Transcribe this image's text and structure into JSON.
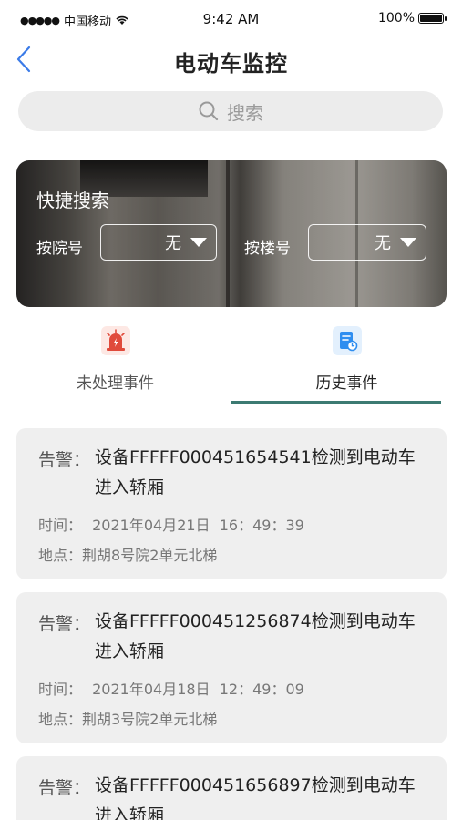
{
  "status_bar": {
    "carrier": "中国移动",
    "time": "9:42 AM",
    "battery": "100%"
  },
  "nav": {
    "title": "电动车监控"
  },
  "search": {
    "placeholder": "搜索"
  },
  "quick_search": {
    "title": "快捷搜索",
    "by_court_label": "按院号",
    "by_court_value": "无",
    "by_building_label": "按楼号",
    "by_building_value": "无"
  },
  "tabs": [
    {
      "label": "未处理事件",
      "icon": "alarm-light-icon",
      "color": "#e04a3b"
    },
    {
      "label": "历史事件",
      "icon": "history-doc-icon",
      "color": "#2f8ef0",
      "active": true
    }
  ],
  "colors": {
    "accent": "#3c7a72",
    "card_bg": "#efefef"
  },
  "events": [
    {
      "alarm_label": "告警：",
      "alarm_text": "设备FFFFF000451654541检测到电动车进入轿厢",
      "time_label": "时间：",
      "time": "2021年04月21日  16：49：39",
      "location_label": "地点：",
      "location": "荆胡8号院2单元北梯"
    },
    {
      "alarm_label": "告警：",
      "alarm_text": "设备FFFFF000451256874检测到电动车进入轿厢",
      "time_label": "时间：",
      "time": "2021年04月18日  12：49：09",
      "location_label": "地点：",
      "location": "荆胡3号院2单元北梯"
    },
    {
      "alarm_label": "告警：",
      "alarm_text": "设备FFFFF000451656897检测到电动车进入轿厢"
    }
  ]
}
